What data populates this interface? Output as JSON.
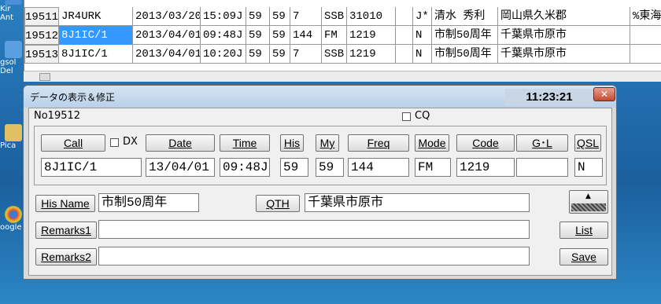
{
  "desktop": {
    "icons": [
      {
        "label": "Kir Ant",
        "color": "#4a90d9"
      },
      {
        "label": "gsol Del",
        "color": "#5aa0e0"
      },
      {
        "label": "Pica",
        "color": "#e0c060"
      },
      {
        "label": "oogle",
        "color": "#d94a3a"
      }
    ]
  },
  "grid": {
    "rows": [
      {
        "no": "19511",
        "call": "JR4URK",
        "date": "2013/03/20",
        "time": "15:09J",
        "his": "59",
        "my": "59",
        "freq": "7",
        "mode": "SSB",
        "code": "31010",
        "gl": "",
        "qsl": "J*",
        "name": "清水 秀利",
        "qth": "岡山県久米郡",
        "extra": "%東海"
      },
      {
        "no": "19512",
        "call": "8J1IC/1",
        "date": "2013/04/01",
        "time": "09:48J",
        "his": "59",
        "my": "59",
        "freq": "144",
        "mode": "FM",
        "code": "1219",
        "gl": "",
        "qsl": "N",
        "name": "市制50周年",
        "qth": "千葉県市原市",
        "extra": ""
      },
      {
        "no": "19513",
        "call": "8J1IC/1",
        "date": "2013/04/01",
        "time": "10:20J",
        "his": "59",
        "my": "59",
        "freq": "7",
        "mode": "SSB",
        "code": "1219",
        "gl": "",
        "qsl": "N",
        "name": "市制50周年",
        "qth": "千葉県市原市",
        "extra": ""
      }
    ]
  },
  "dialog": {
    "title": "データの表示＆修正",
    "clock": "11:23:21",
    "close": "✕",
    "record_no": "No19512",
    "cq_label": "CQ",
    "dx_label": "DX",
    "buttons": {
      "call": "Call",
      "date": "Date",
      "time": "Time",
      "his": "His",
      "my": "My",
      "freq": "Freq",
      "mode": "Mode",
      "code": "Code",
      "gl": "G･L",
      "qsl": "QSL",
      "his_name": "His Name",
      "qth": "QTH",
      "remarks1": "Remarks1",
      "remarks2": "Remarks2",
      "list": "List",
      "save": "Save"
    },
    "fields": {
      "call": "8J1IC/1",
      "date": "13/04/01",
      "time": "09:48J",
      "his": "59",
      "my": "59",
      "freq": "144",
      "mode": "FM",
      "code": "1219",
      "gl": "",
      "qsl": "N",
      "his_name": "市制50周年",
      "qth": "千葉県市原市",
      "remarks1": "",
      "remarks2": ""
    }
  }
}
